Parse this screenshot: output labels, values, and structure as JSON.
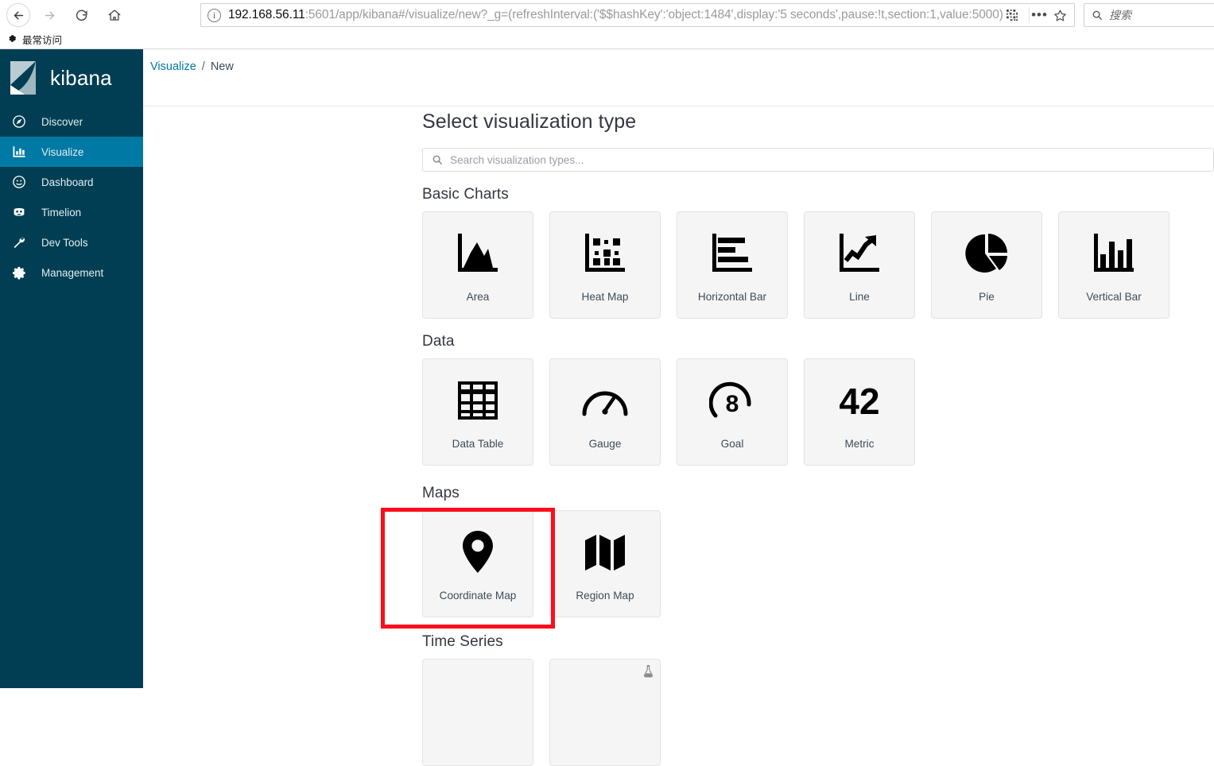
{
  "browser": {
    "nav": {
      "back_icon": "arrow-left-icon",
      "forward_icon": "arrow-right-icon",
      "reload_icon": "reload-icon",
      "home_icon": "home-icon"
    },
    "url_bar": {
      "site_info_icon": "info-icon",
      "host": "192.168.56.11",
      "path": ":5601/app/kibana#/visualize/new?_g=(refreshInterval:('$$hashKey':'object:1484',display:'5 seconds',pause:!t,section:1,value:5000)",
      "reader_icon": "reader-view-icon",
      "menu_icon": "ellipsis-icon",
      "bookmark_icon": "star-icon"
    },
    "search": {
      "icon": "search-icon",
      "placeholder": "搜索"
    },
    "bookmarks": {
      "icon": "most-visited-icon",
      "label": "最常访问"
    }
  },
  "sidebar": {
    "brand": "kibana",
    "items": [
      {
        "label": "Discover",
        "icon": "compass-icon",
        "active": false
      },
      {
        "label": "Visualize",
        "icon": "bar-chart-icon",
        "active": true
      },
      {
        "label": "Dashboard",
        "icon": "dashboard-icon",
        "active": false
      },
      {
        "label": "Timelion",
        "icon": "timelion-icon",
        "active": false
      },
      {
        "label": "Dev Tools",
        "icon": "wrench-icon",
        "active": false
      },
      {
        "label": "Management",
        "icon": "gear-icon",
        "active": false
      }
    ]
  },
  "breadcrumb": {
    "root": "Visualize",
    "separator": "/",
    "current": "New"
  },
  "wizard": {
    "title": "Select visualization type",
    "search_placeholder": "Search visualization types...",
    "search_icon": "search-icon",
    "groups": [
      {
        "title": "Basic Charts",
        "tiles": [
          {
            "label": "Area",
            "icon": "area-chart-icon"
          },
          {
            "label": "Heat Map",
            "icon": "heat-map-icon"
          },
          {
            "label": "Horizontal Bar",
            "icon": "horizontal-bar-icon"
          },
          {
            "label": "Line",
            "icon": "line-chart-icon"
          },
          {
            "label": "Pie",
            "icon": "pie-chart-icon"
          },
          {
            "label": "Vertical Bar",
            "icon": "vertical-bar-icon"
          }
        ]
      },
      {
        "title": "Data",
        "tiles": [
          {
            "label": "Data Table",
            "icon": "table-grid-icon"
          },
          {
            "label": "Gauge",
            "icon": "gauge-icon"
          },
          {
            "label": "Goal",
            "icon": "goal-icon",
            "icon_text": "8"
          },
          {
            "label": "Metric",
            "icon": "metric-icon",
            "icon_text": "42"
          }
        ]
      },
      {
        "title": "Maps",
        "tiles": [
          {
            "label": "Coordinate Map",
            "icon": "map-marker-icon",
            "highlighted": true
          },
          {
            "label": "Region Map",
            "icon": "folded-map-icon"
          }
        ]
      },
      {
        "title": "Time Series",
        "tiles": [
          {
            "label": "",
            "icon": "timeseries-icon"
          },
          {
            "label": "",
            "icon": "timeseries-icon",
            "experimental_badge": "flask-icon"
          }
        ]
      }
    ]
  },
  "annotation": {
    "target": "Coordinate Map",
    "color": "#fc0d1b"
  }
}
